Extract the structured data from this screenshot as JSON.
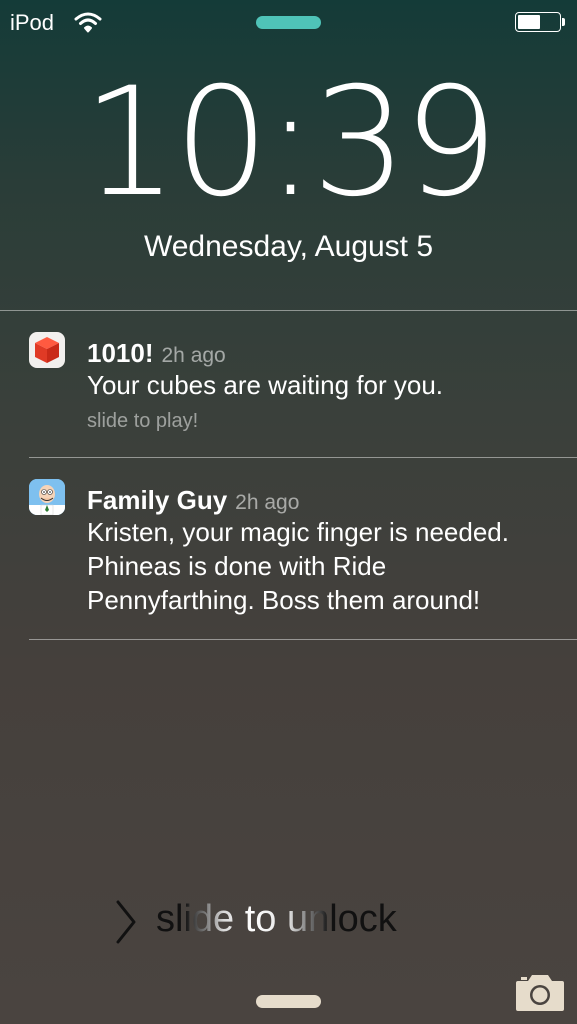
{
  "status_bar": {
    "carrier": "iPod",
    "wifi_icon": "wifi-icon",
    "battery_icon": "battery-icon",
    "battery_level": 0.55,
    "grabber_color": "#4fc3b8"
  },
  "clock": {
    "time": "10:39",
    "date": "Wednesday, August 5"
  },
  "notifications": [
    {
      "app": "1010!",
      "time": "2h ago",
      "message": "Your cubes are waiting for you.",
      "action": "slide to play!",
      "icon": "red-cube-icon"
    },
    {
      "app": "Family Guy",
      "time": "2h ago",
      "message": "Kristen, your magic finger is needed. Phineas is done with Ride Pennyfarthing. Boss them around!",
      "icon": "family-guy-app-icon"
    }
  ],
  "unlock": {
    "label": "slide to unlock",
    "chevron_icon": "chevron-right-icon"
  },
  "camera_icon": "camera-icon",
  "colors": {
    "grabber_bottom": "#e6dccb",
    "camera": "#e6dccb"
  }
}
